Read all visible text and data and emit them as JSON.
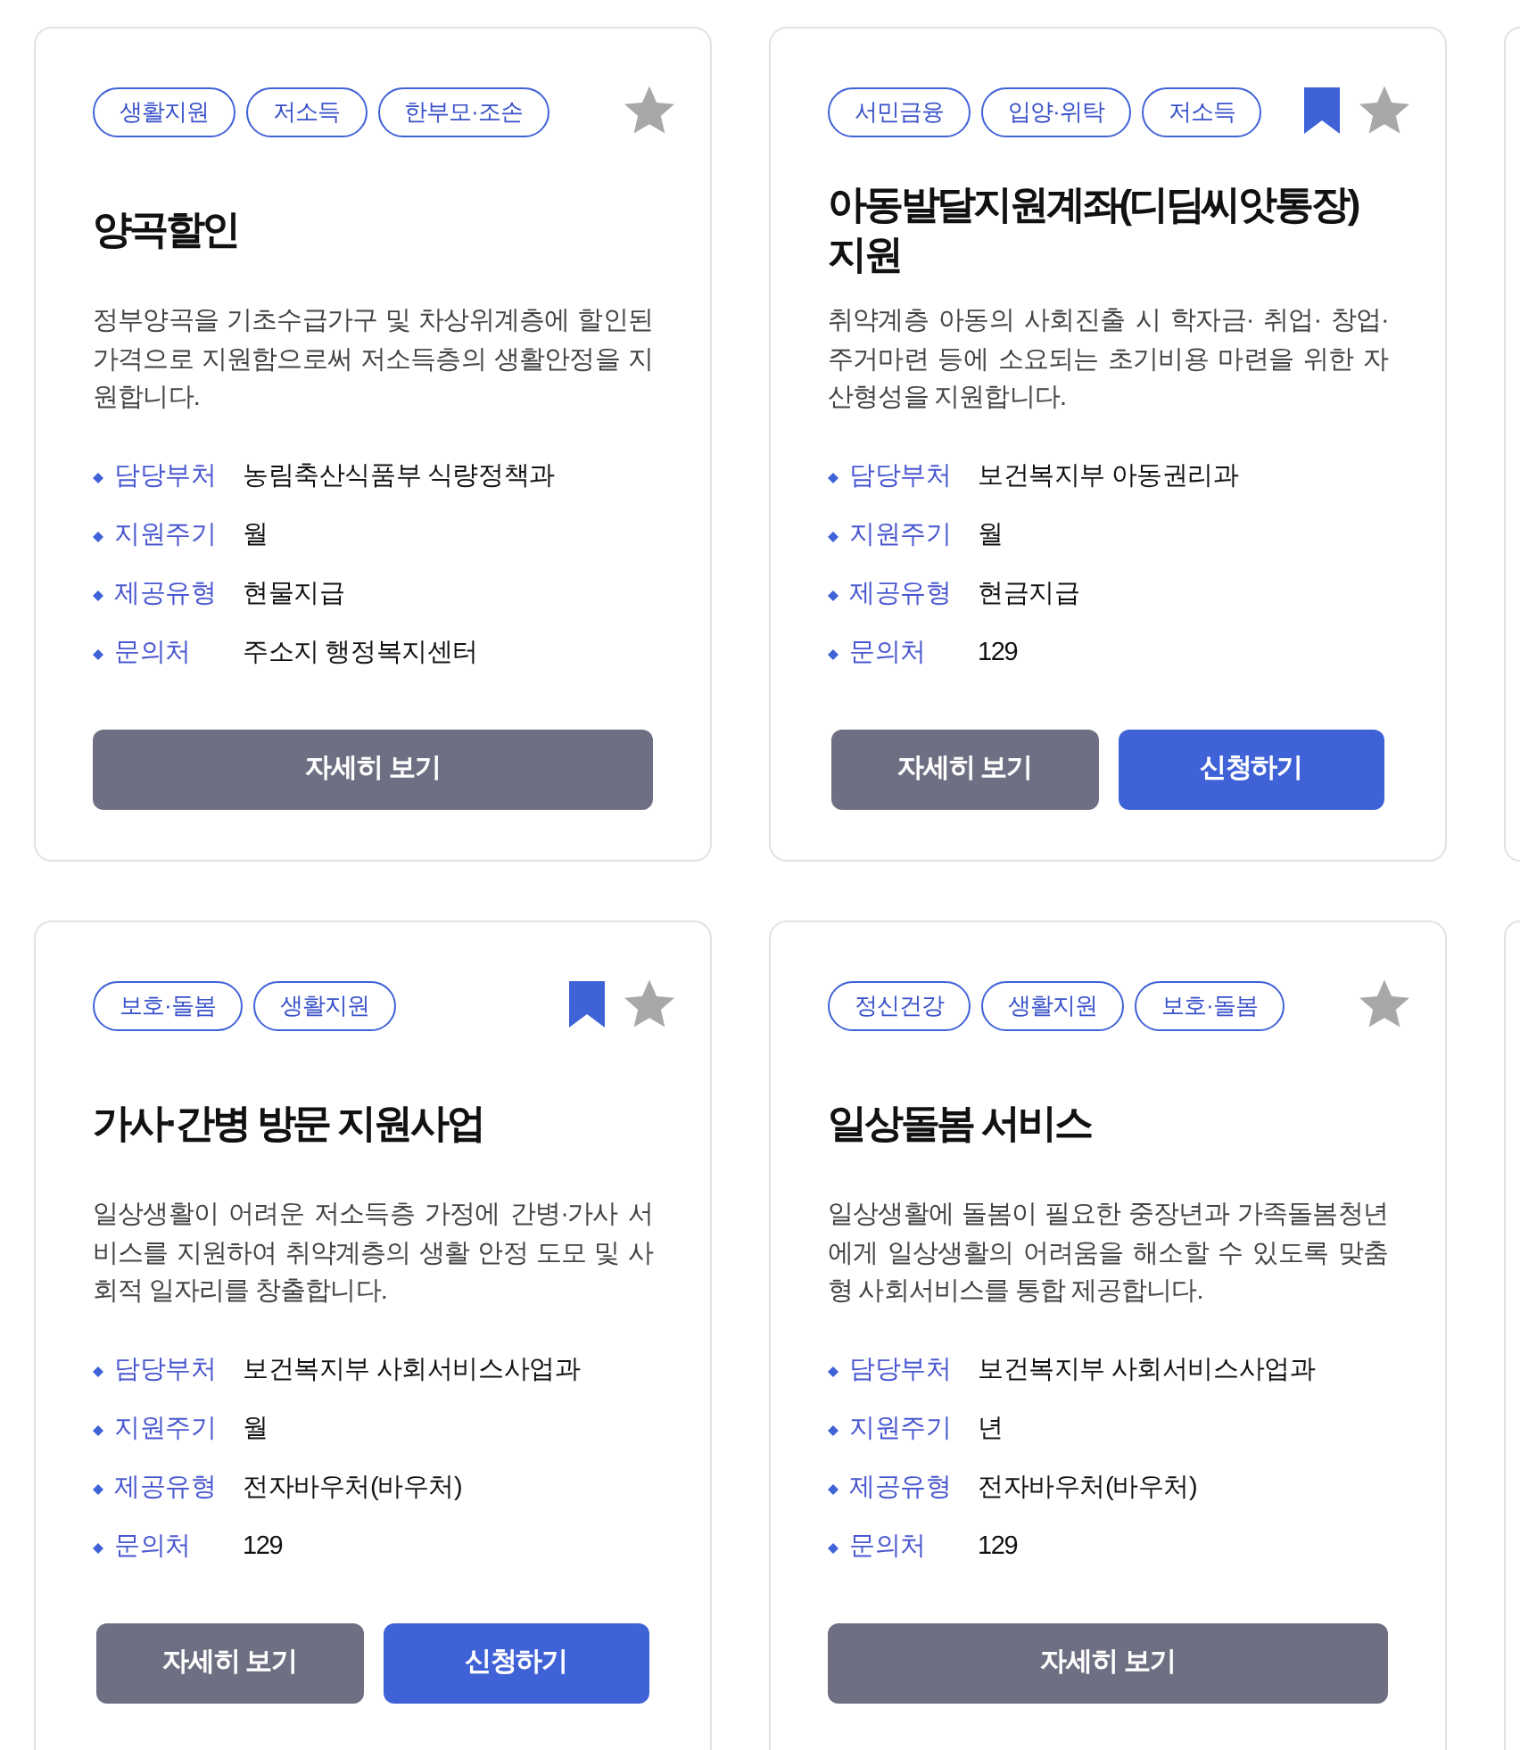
{
  "card_rows": [
    {
      "cards": [
        {
          "tags": [
            "생활지원",
            "저소득",
            "한부모·조손"
          ],
          "bookmarked": false,
          "starred": false,
          "title": "양곡할인",
          "description": "정부양곡을 기초수급가구 및 차상위계층에 할인된 가격으로 지원함으로써 저소득층의 생활안정을 지원합니다.",
          "details": [
            {
              "label": "담당부처",
              "value": "농림축산식품부 식량정책과"
            },
            {
              "label": "지원주기",
              "value": "월"
            },
            {
              "label": "제공유형",
              "value": "현물지급"
            },
            {
              "label": "문의처",
              "value": "주소지 행정복지센터"
            }
          ],
          "buttons": [
            {
              "label": "자세히 보기",
              "kind": "secondary"
            }
          ]
        },
        {
          "tags": [
            "서민금융",
            "입양·위탁",
            "저소득"
          ],
          "bookmarked": true,
          "starred": false,
          "title": "아동발달지원계좌(디딤씨앗통장)지원",
          "description": "취약계층 아동의 사회진출 시 학자금· 취업· 창업· 주거마련 등에 소요되는 초기비용 마련을 위한 자산형성을 지원합니다.",
          "details": [
            {
              "label": "담당부처",
              "value": "보건복지부 아동권리과"
            },
            {
              "label": "지원주기",
              "value": "월"
            },
            {
              "label": "제공유형",
              "value": "현금지급"
            },
            {
              "label": "문의처",
              "value": "129"
            }
          ],
          "buttons": [
            {
              "label": "자세히 보기",
              "kind": "secondary"
            },
            {
              "label": "신청하기",
              "kind": "primary"
            }
          ]
        }
      ]
    },
    {
      "cards": [
        {
          "tags": [
            "보호·돌봄",
            "생활지원"
          ],
          "bookmarked": true,
          "starred": false,
          "title": "가사·간병 방문 지원사업",
          "description": "일상생활이 어려운 저소득층 가정에 간병·가사 서비스를 지원하여 취약계층의 생활 안정 도모 및 사회적 일자리를 창출합니다.",
          "details": [
            {
              "label": "담당부처",
              "value": "보건복지부 사회서비스사업과"
            },
            {
              "label": "지원주기",
              "value": "월"
            },
            {
              "label": "제공유형",
              "value": "전자바우처(바우처)"
            },
            {
              "label": "문의처",
              "value": "129"
            }
          ],
          "buttons": [
            {
              "label": "자세히 보기",
              "kind": "secondary"
            },
            {
              "label": "신청하기",
              "kind": "primary"
            }
          ]
        },
        {
          "tags": [
            "정신건강",
            "생활지원",
            "보호·돌봄"
          ],
          "bookmarked": false,
          "starred": false,
          "title": "일상돌봄 서비스",
          "description": "일상생활에 돌봄이 필요한 중장년과 가족돌봄청년에게 일상생활의 어려움을 해소할 수 있도록 맞춤형 사회서비스를 통합 제공합니다.",
          "details": [
            {
              "label": "담당부처",
              "value": "보건복지부 사회서비스사업과"
            },
            {
              "label": "지원주기",
              "value": "년"
            },
            {
              "label": "제공유형",
              "value": "전자바우처(바우처)"
            },
            {
              "label": "문의처",
              "value": "129"
            }
          ],
          "buttons": [
            {
              "label": "자세히 보기",
              "kind": "secondary"
            }
          ]
        }
      ]
    }
  ]
}
